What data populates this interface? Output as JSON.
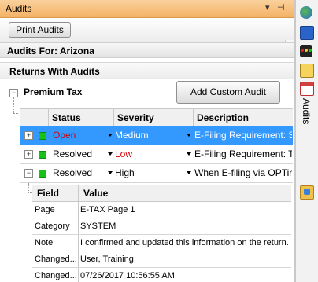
{
  "window": {
    "title": "Audits"
  },
  "toolbar": {
    "print_label": "Print Audits"
  },
  "audits_for": "Audits For: Arizona",
  "returns_header": "Returns With Audits",
  "group": {
    "name": "Premium Tax",
    "add_button_label": "Add Custom Audit"
  },
  "grid": {
    "columns": [
      "Status",
      "Severity",
      "Description"
    ],
    "rows": [
      {
        "status": "Open",
        "severity": "Medium",
        "description": "E-Filing Requirement: S...",
        "status_color": "#d40000",
        "severity_color": "#ffffff",
        "selected": true
      },
      {
        "status": "Resolved",
        "severity": "Low",
        "description": "E-Filing Requirement: T...",
        "status_color": "#000000",
        "severity_color": "#d40000",
        "selected": false
      },
      {
        "status": "Resolved",
        "severity": "High",
        "description": "When E-filing via OPTin...",
        "status_color": "#000000",
        "severity_color": "#000000",
        "selected": false
      }
    ]
  },
  "detail": {
    "columns": [
      "Field",
      "Value"
    ],
    "rows": [
      {
        "field": "Page",
        "value": "E-TAX Page 1"
      },
      {
        "field": "Category",
        "value": "SYSTEM"
      },
      {
        "field": "Note",
        "value": "I confirmed and updated this information on the return."
      },
      {
        "field": "Changed...",
        "value": "User, Training"
      },
      {
        "field": "Changed...",
        "value": "07/26/2017  10:56:55 AM"
      }
    ]
  },
  "sidebar": {
    "tab_label": "Audits",
    "icons": [
      "globe-icon",
      "book-icon",
      "traffic-light-icon",
      "note-icon",
      "calendar-icon",
      "folder-icon"
    ]
  },
  "colors": {
    "titlebar": "#f4b265",
    "selected_row": "#3399ff",
    "status_ok": "#18c018"
  }
}
